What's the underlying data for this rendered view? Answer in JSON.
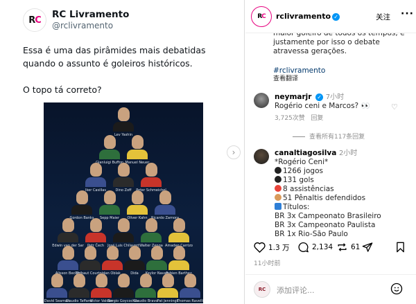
{
  "tweet": {
    "avatar_text_a": "R",
    "avatar_text_b": "C",
    "name": "RC Livramento",
    "handle": "@rclivramento",
    "paragraph1": "Essa é uma das pirâmides mais debatidas quando o assunto é goleiros históricos.",
    "paragraph2": "O topo tá correto?"
  },
  "pyramid": {
    "rows": [
      [
        "Lev Yashin"
      ],
      [
        "Gianluigi Buffon",
        "Manuel Neuer"
      ],
      [
        "Iker Casillas",
        "Dino Zoff",
        "Peter Schmeichel"
      ],
      [
        "Gordon Banks",
        "Sepp Maier",
        "Oliver Kahn",
        "Ricardo Zamora"
      ],
      [
        "Edwin van der Sar",
        "Petr Čech",
        "José Luis Chilavert",
        "Walter Zenga",
        "Amadeo Carrizo"
      ],
      [
        "Alisson Becker",
        "Thibaut Courtois",
        "Jan Oblak",
        "Dida",
        "Keylor Navas",
        "Fabien Barthez"
      ],
      [
        "David Seaman",
        "Claudio Taffarel",
        "Víctor Valdés",
        "Sergio Goycochea",
        "Claudio Bravo",
        "Pat Jennings",
        "Thomas Ravelli"
      ]
    ],
    "kit_colors": [
      "#1b1b1b",
      "#2e6f3c",
      "#e3c23a",
      "#3a4f8f",
      "#2b2b2b",
      "#c8342a"
    ]
  },
  "instagram": {
    "avatar_text_a": "R",
    "avatar_text_b": "C",
    "username": "rclivramento",
    "verified_mark": "✓",
    "follow_label": "关注",
    "more_label": "···",
    "caption": "maior goleiro de todos os tempos, e justamente por isso o debate atravessa gerações.",
    "hashtag": "#rclivramento",
    "see_translation": "查看翻译",
    "comment1": {
      "user": "neymarjr",
      "time": "7小时",
      "text": "Rogério ceni e Marcos? 👀",
      "likes": "3,725次赞",
      "reply": "回复"
    },
    "view_all": "查看所有117条回复",
    "comment2": {
      "user": "canaltiagosilva",
      "time": "2小时",
      "lines": [
        "*Rogério Ceni*",
        "1266 jogos",
        "131 gols",
        "8 assistências",
        "51 Pênaltis defendidos",
        "Títulos:",
        "BR 3x Campeonato Brasileiro",
        "BR 3x Campeonato Paulista",
        "BR 1x Rio-São Paulo"
      ]
    },
    "likes_count": "1.3 万",
    "comments_count": "2,134",
    "shares_count": "61",
    "time_ago": "11小时前",
    "add_comment_placeholder": "添加评论...",
    "commenter_avatar_text": "RC"
  }
}
